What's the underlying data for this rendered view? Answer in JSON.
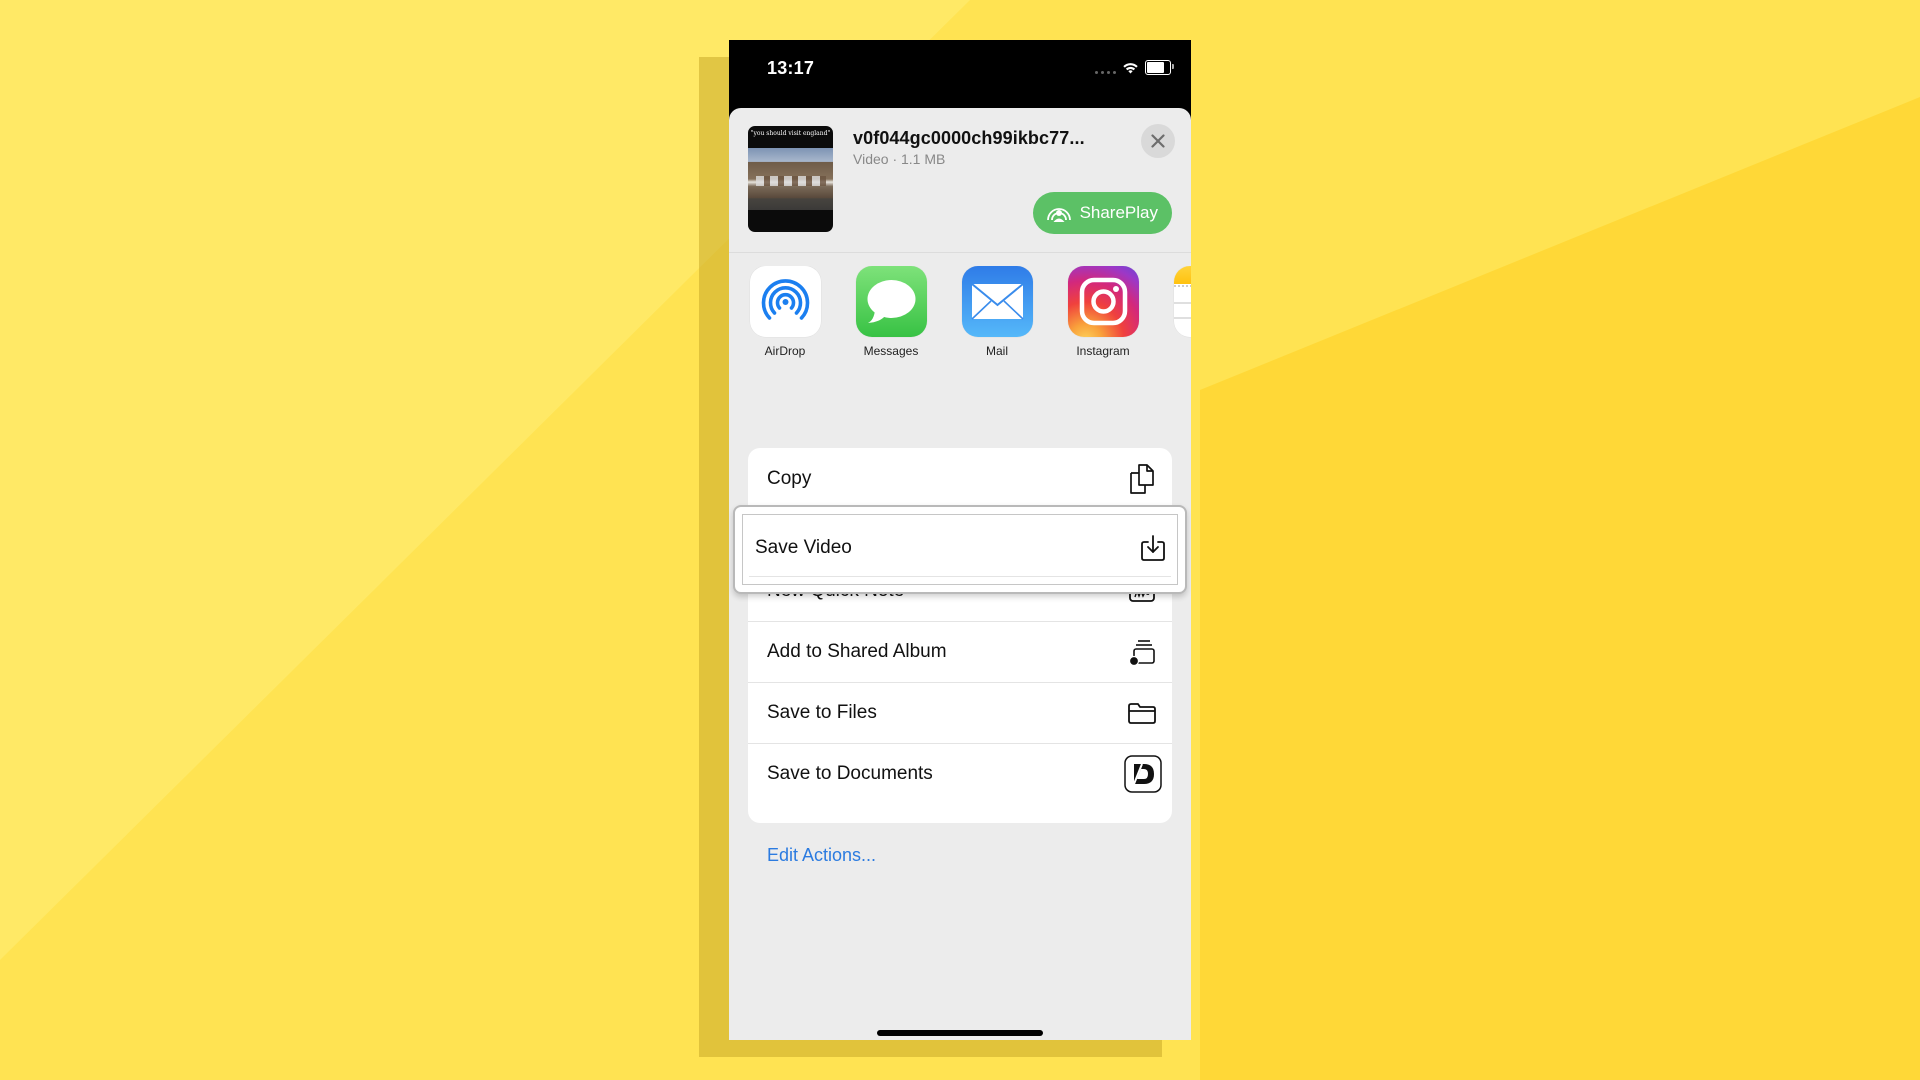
{
  "status_bar": {
    "time": "13:17",
    "icons": [
      "signal-dots-icon",
      "wifi-icon",
      "battery-icon"
    ]
  },
  "share_sheet": {
    "file": {
      "name": "v0f044gc0000ch99ikbc77...",
      "meta": "Video · 1.1 MB",
      "thumbnail_caption": "\"you should visit england\""
    },
    "close_icon": "close-icon",
    "shareplay_label": "SharePlay",
    "apps": [
      {
        "label": "AirDrop",
        "icon": "airdrop-icon"
      },
      {
        "label": "Messages",
        "icon": "messages-icon"
      },
      {
        "label": "Mail",
        "icon": "mail-icon"
      },
      {
        "label": "Instagram",
        "icon": "instagram-icon"
      },
      {
        "label": "",
        "icon": "notes-icon"
      }
    ],
    "actions": [
      {
        "label": "Copy",
        "icon": "copy-icon"
      },
      {
        "label": "Save Video",
        "icon": "save-download-icon",
        "highlighted": true
      },
      {
        "label": "New Quick Note",
        "icon": "quick-note-icon"
      },
      {
        "label": "Add to Shared Album",
        "icon": "shared-album-icon"
      },
      {
        "label": "Save to Files",
        "icon": "folder-icon"
      },
      {
        "label": "Save to Documents",
        "icon": "documents-app-icon"
      }
    ],
    "edit_actions_label": "Edit Actions..."
  },
  "colors": {
    "background": "#ffe966",
    "shareplay_green": "#5cc166",
    "link_blue": "#2b7be0",
    "sheet_bg": "#ececec"
  }
}
